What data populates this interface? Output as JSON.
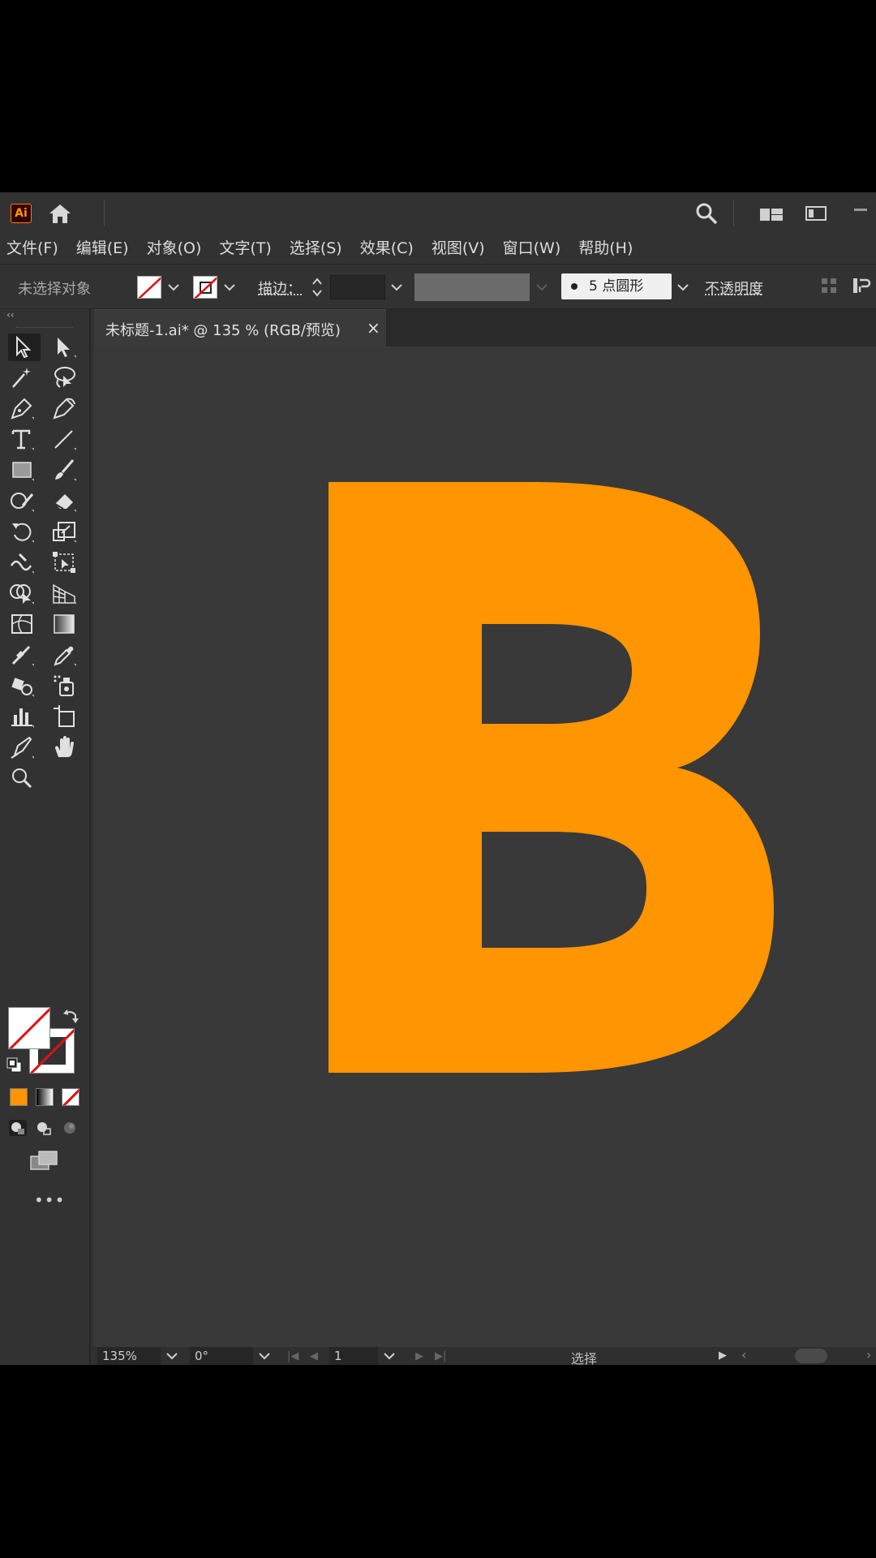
{
  "titlebar": {
    "app_logo": "Ai",
    "icons": [
      "home-icon",
      "search-icon",
      "workspace-icon",
      "screen-icon",
      "minimize-icon"
    ]
  },
  "menubar": {
    "items": [
      "文件(F)",
      "编辑(E)",
      "对象(O)",
      "文字(T)",
      "选择(S)",
      "效果(C)",
      "视图(V)",
      "窗口(W)",
      "帮助(H)"
    ]
  },
  "controlbar": {
    "selection_label": "未选择对象",
    "stroke_label": "描边：",
    "brush_label": "5 点圆形",
    "opacity_label": "不透明度"
  },
  "document": {
    "tab_title": "未标题-1.ai* @ 135 % (RGB/预览)",
    "close_glyph": "×",
    "artwork_letter": "B",
    "artwork_color": "#ff9500"
  },
  "toolbar": {
    "collapse_glyph": "‹‹",
    "more_glyph": "•••",
    "fill_color": "#ff9500",
    "tools": [
      "selection-tool",
      "direct-selection-tool",
      "magic-wand-tool",
      "lasso-tool",
      "pen-tool",
      "curvature-tool",
      "type-tool",
      "line-segment-tool",
      "rectangle-tool",
      "paintbrush-tool",
      "shaper-tool",
      "eraser-tool",
      "rotate-tool",
      "scale-tool",
      "warp-tool",
      "free-transform-tool",
      "shape-builder-tool",
      "perspective-grid-tool",
      "mesh-tool",
      "gradient-tool",
      "blend-tool",
      "eyedropper-tool",
      "live-paint-bucket-tool",
      "symbol-sprayer-tool",
      "column-graph-tool",
      "artboard-tool",
      "slice-tool",
      "hand-tool",
      "zoom-tool"
    ]
  },
  "statusbar": {
    "zoom": "135%",
    "rotation": "0°",
    "artboard": "1",
    "status": "选择"
  },
  "colors": {
    "accent": "#ff9500",
    "panel": "#323232",
    "canvas": "#393939"
  }
}
